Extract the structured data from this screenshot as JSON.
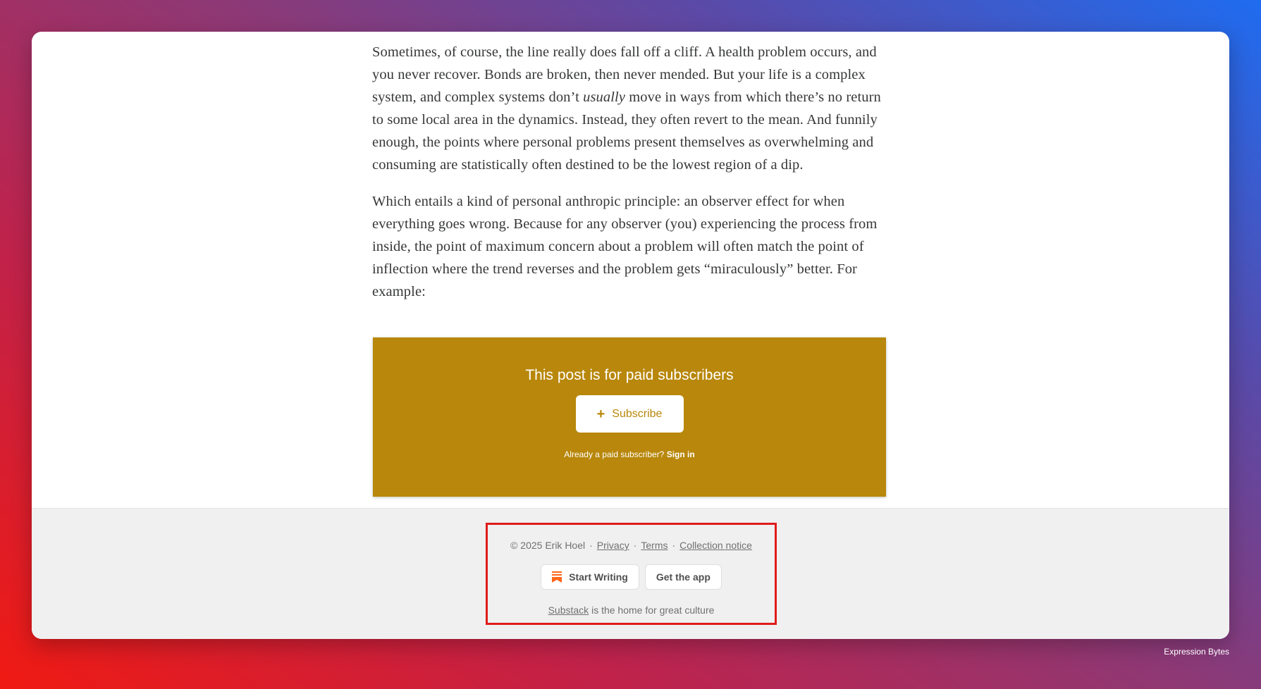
{
  "article": {
    "p1_a": "Sometimes, of course, the line really does fall off a cliff. A health problem occurs, and you never recover. Bonds are broken, then never mended. But your life is a complex system, and complex systems don’t ",
    "p1_em": "usually",
    "p1_b": " move in ways from which there’s no return to some local area in the dynamics. Instead, they often revert to the mean. And funnily enough, the points where personal problems present themselves as overwhelming and consuming are statistically often destined to be the lowest region of a dip.",
    "p2": "Which entails a kind of personal anthropic principle: an observer effect for when everything goes wrong. Because for any observer (you) experiencing the process from inside, the point of maximum concern about a problem will often match the point of inflection where the trend reverses and the problem gets “miraculously” better. For example:"
  },
  "paywall": {
    "title": "This post is for paid subscribers",
    "subscribe_icon": "+",
    "subscribe_label": "Subscribe",
    "already_text": "Already a paid subscriber?",
    "signin_label": "Sign in",
    "bg_color": "#b8870b"
  },
  "footer": {
    "copyright": "© 2025 Erik Hoel",
    "sep": "·",
    "privacy": "Privacy",
    "terms": "Terms",
    "collection_notice": "Collection notice",
    "start_writing": "Start Writing",
    "get_app": "Get the app",
    "tagline_link": "Substack",
    "tagline_rest": " is the home for great culture",
    "highlight_color": "#e01b1b"
  },
  "watermark": "Expression Bytes"
}
